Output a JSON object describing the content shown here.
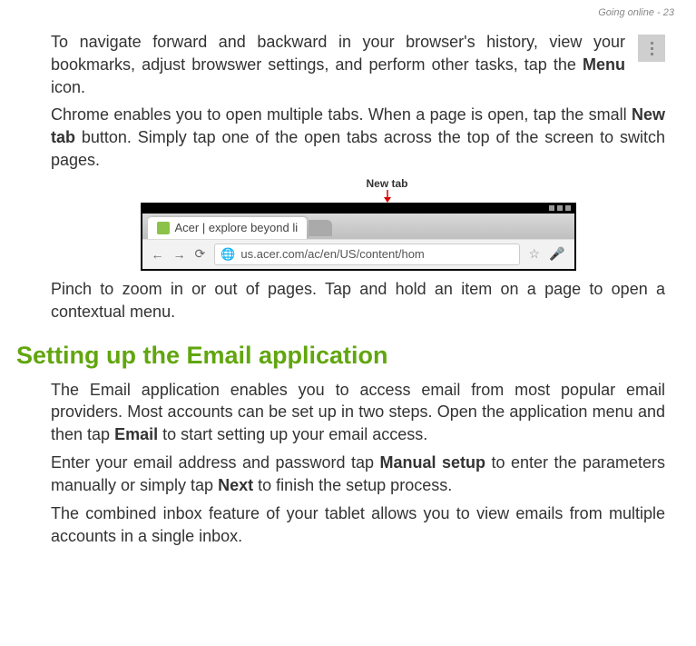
{
  "header": {
    "text": "Going online - 23"
  },
  "paragraphs": {
    "p1_before": "To navigate forward and backward in your browser's history, view your bookmarks, adjust browswer settings, and perform other tasks, tap the ",
    "p1_bold": "Menu",
    "p1_after": " icon.",
    "p2_before": "Chrome enables you to open multiple tabs. When a page is open, tap the small ",
    "p2_bold": "New tab",
    "p2_after": " button. Simply tap one of the open tabs across the top of the screen to switch pages.",
    "p3": "Pinch to zoom in or out of pages. Tap and hold an item on a page to open a contextual menu.",
    "p4_before": "The Email application enables you to access email from most popular email providers. Most accounts can be set up in two steps. Open the application menu and then tap ",
    "p4_bold": "Email",
    "p4_after": " to start setting up your email access.",
    "p5_before": "Enter your email address and password tap ",
    "p5_bold1": "Manual setup",
    "p5_mid": " to enter the parameters manually or simply tap ",
    "p5_bold2": "Next",
    "p5_after": " to finish the setup process.",
    "p6": "The combined inbox feature of your tablet allows you to view emails from multiple accounts in a single inbox."
  },
  "figure": {
    "label": "New tab",
    "tab_title": "Acer | explore beyond li",
    "url": "us.acer.com/ac/en/US/content/hom"
  },
  "section_heading": "Setting up the Email application"
}
